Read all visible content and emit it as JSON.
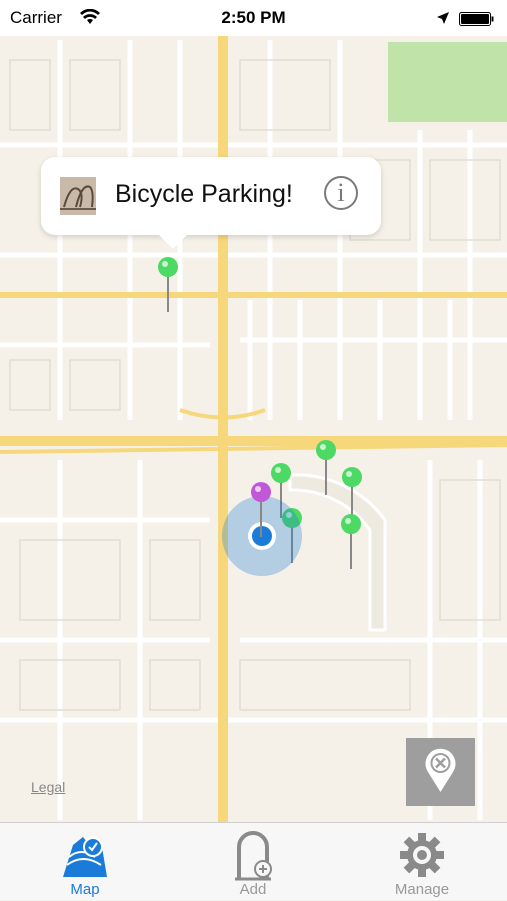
{
  "status": {
    "carrier": "Carrier",
    "time": "2:50 PM"
  },
  "map": {
    "legal": "Legal"
  },
  "callout": {
    "title": "Bicycle Parking!",
    "info_icon": "info-icon"
  },
  "pins": {
    "green_color": "#4cd964",
    "purple_color": "#c058d8",
    "user_color": "#1a7cd8"
  },
  "tabs": [
    {
      "label": "Map",
      "icon": "map-pin-icon",
      "active": true
    },
    {
      "label": "Add",
      "icon": "add-bike-rack-icon",
      "active": false
    },
    {
      "label": "Manage",
      "icon": "gear-icon",
      "active": false
    }
  ],
  "colors": {
    "accent": "#1a7cd8",
    "road_major": "#f7d77b",
    "road_minor": "#ffffff",
    "park": "#bfe3a8"
  }
}
